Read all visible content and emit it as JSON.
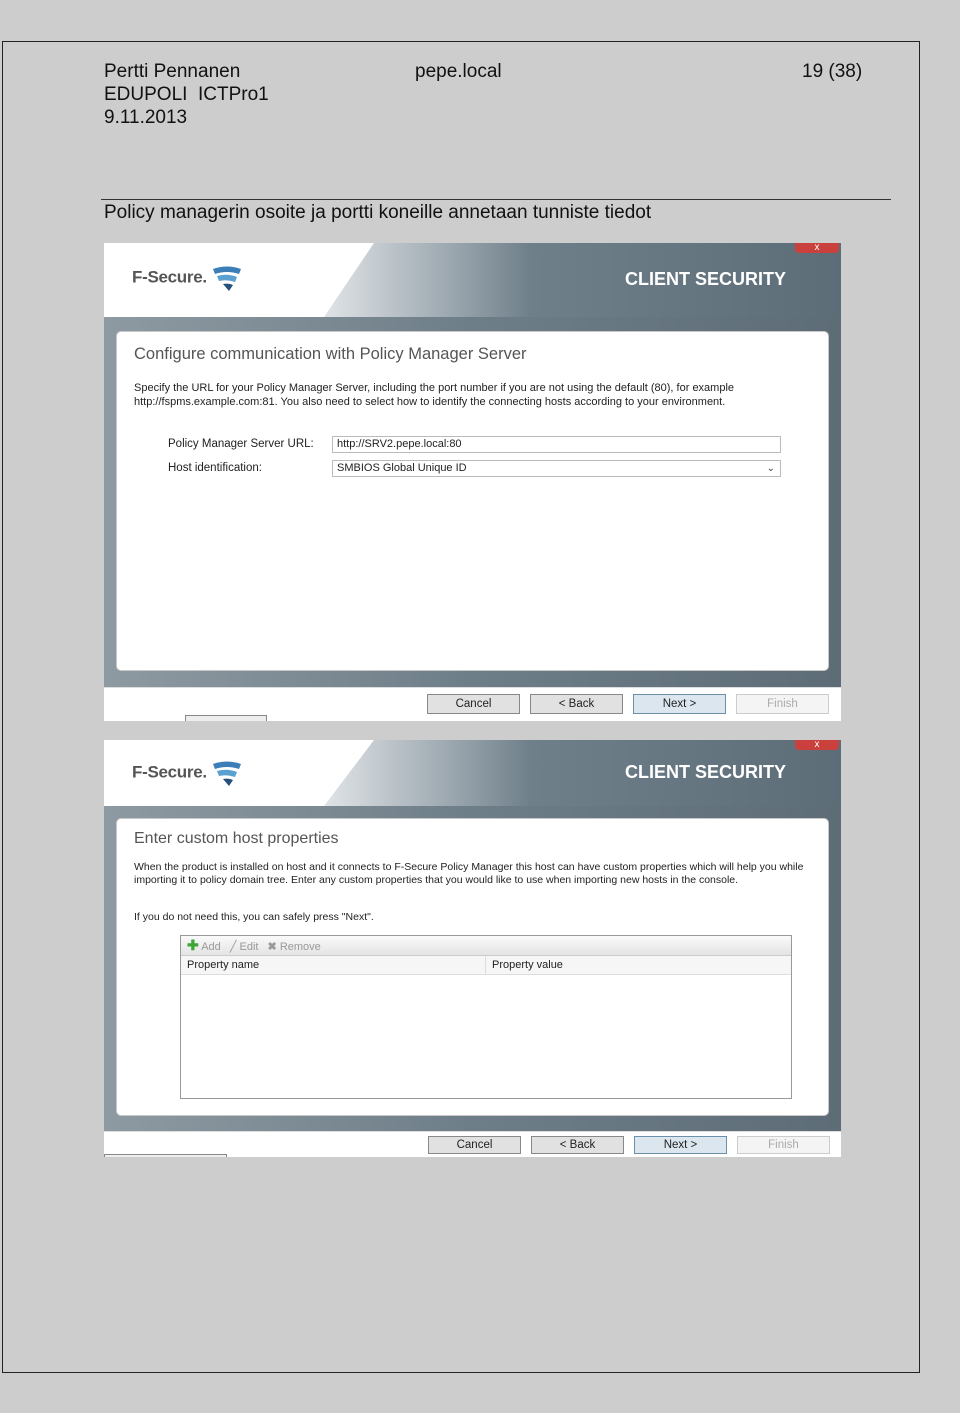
{
  "header": {
    "author": "Pertti Pennanen",
    "org": "EDUPOLI  ICTPro1",
    "date": "9.11.2013",
    "domain": "pepe.local",
    "page": "19 (38)"
  },
  "caption": "Policy managerin osoite ja portti koneille annetaan tunniste tiedot",
  "dialog1": {
    "brand": "F-Secure.",
    "product": "CLIENT SECURITY",
    "close": "x",
    "title": "Configure communication with Policy Manager Server",
    "description": "Specify the URL for your Policy Manager Server, including the port number if you are not using the default (80), for example http://fspms.example.com:81. You also need to select how to identify the connecting hosts according to your environment.",
    "url_label": "Policy Manager Server URL:",
    "url_value": "http://SRV2.pepe.local:80",
    "host_label": "Host identification:",
    "host_value": "SMBIOS Global Unique ID",
    "buttons": {
      "cancel": "Cancel",
      "back": "< Back",
      "next": "Next >",
      "finish": "Finish"
    }
  },
  "dialog2": {
    "brand": "F-Secure.",
    "product": "CLIENT SECURITY",
    "close": "x",
    "title": "Enter custom host properties",
    "description": "When the product is installed on host and it connects to F-Secure Policy Manager this host can have custom properties which will help you while importing it to policy domain tree. Enter any custom properties that you would like to use when importing new hosts in the console.",
    "hint": "If you do not need this, you can safely press \"Next\".",
    "toolbar": {
      "add": "Add",
      "edit": "Edit",
      "remove": "Remove"
    },
    "columns": [
      "Property name",
      "Property value"
    ],
    "buttons": {
      "cancel": "Cancel",
      "back": "< Back",
      "next": "Next >",
      "finish": "Finish"
    }
  },
  "colors": {
    "banner": "#5d6d78",
    "close": "#c9403c",
    "next_button": "#dbe6ee",
    "add_icon": "#3fa535"
  }
}
